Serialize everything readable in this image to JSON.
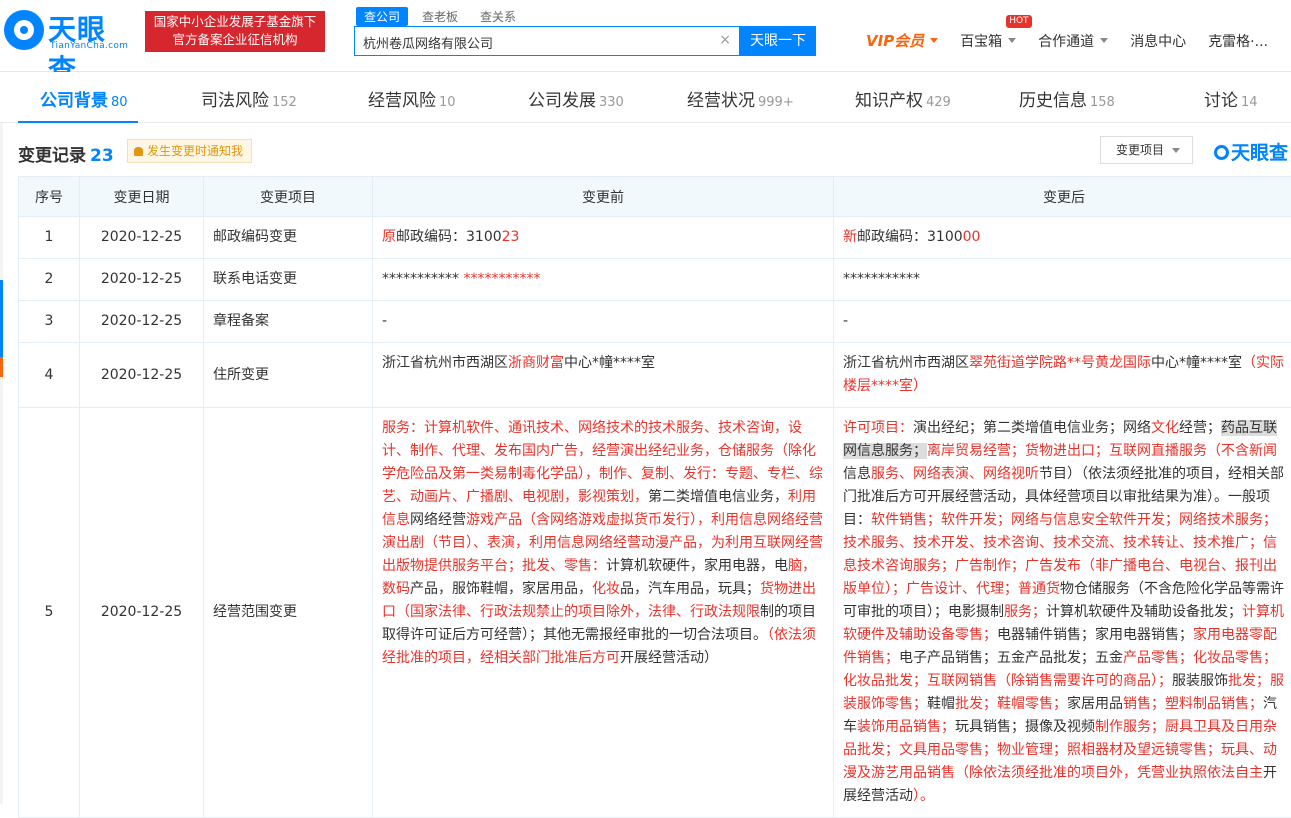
{
  "header": {
    "logo_text": "天眼查",
    "logo_sub": "TianYanCha.com",
    "gov_badge_line1": "国家中小企业发展子基金旗下",
    "gov_badge_line2": "官方备案企业征信机构",
    "search_tabs": [
      "查公司",
      "查老板",
      "查关系"
    ],
    "search_value": "杭州卷瓜网络有限公司",
    "search_button": "天眼一下",
    "nav": {
      "vip": "VIP会员",
      "treasure": "百宝箱",
      "hot": "HOT",
      "partner": "合作通道",
      "messages": "消息中心",
      "user": "克雷格·..."
    }
  },
  "tabs": [
    {
      "label": "公司背景",
      "count": "80"
    },
    {
      "label": "司法风险",
      "count": "152"
    },
    {
      "label": "经营风险",
      "count": "10"
    },
    {
      "label": "公司发展",
      "count": "330"
    },
    {
      "label": "经营状况",
      "count": "999+"
    },
    {
      "label": "知识产权",
      "count": "429"
    },
    {
      "label": "历史信息",
      "count": "158"
    },
    {
      "label": "讨论",
      "count": "14"
    }
  ],
  "section": {
    "title": "变更记录",
    "count": "23",
    "notify": "发生变更时通知我",
    "filter": "变更项目",
    "brand": "天眼查"
  },
  "table": {
    "headers": [
      "序号",
      "变更日期",
      "变更项目",
      "变更前",
      "变更后"
    ],
    "rows": [
      {
        "no": "1",
        "date": "2020-12-25",
        "item": "邮政编码变更"
      },
      {
        "no": "2",
        "date": "2020-12-25",
        "item": "联系电话变更"
      },
      {
        "no": "3",
        "date": "2020-12-25",
        "item": "章程备案",
        "before": "-",
        "after": "-"
      },
      {
        "no": "4",
        "date": "2020-12-25",
        "item": "住所变更"
      },
      {
        "no": "5",
        "date": "2020-12-25",
        "item": "经营范围变更"
      }
    ],
    "r1": {
      "before_a": "原",
      "before_b": "邮政编码：3100",
      "before_c": "23",
      "after_a": "新",
      "after_b": "邮政编码：3100",
      "after_c": "00"
    },
    "r2": {
      "before_a": "*********** ",
      "before_b": "***********",
      "after": "***********"
    },
    "r4": {
      "before_a": "浙江省杭州市西湖区",
      "before_b": "浙商财富",
      "before_c": "中心*幢****室",
      "after_a": "浙江省杭州市西湖区",
      "after_b": "翠苑街道学院路**号黄龙国际",
      "after_c": "中心*幢****室",
      "after_d": "（实际楼层****室）"
    },
    "r5": {
      "before_1": "服务：计算机软件、通讯技术、网络技术的技术服务、技术咨询，设计、制作、代理、发布国内广告，经营演出经纪业务，仓储服务（除化学危险品及第一类易制毒化学品），制作、复制、发行：专题、专栏、综艺、动画片、广播剧、电视剧，影视策划，",
      "before_2": "第二类增值电信业务，",
      "before_3": "利用信息",
      "before_4": "网络经营",
      "before_5": "游戏产品（含网络游戏虚拟货币发行），利用信息网络经营演出剧（节目）、表演，利用信息网络经营动漫产品，为利用互联网经营出版物提供服务平台；批发、零售：",
      "before_6": "计算机软硬件，家用电器，电",
      "before_7": "脑，数码",
      "before_8": "产品，服饰鞋帽，家居用品，",
      "before_9": "化妆",
      "before_10": "品，汽车用品，玩具；",
      "before_11": "货物进出口（国家法律、行政法规禁止的项目除外，法律、行政法规限",
      "before_12": "制的项目取得许可证后方可经营）；其他无需报经审批的一切合法项目。",
      "before_13": "（依法须经批准的项目，经相关部门批准后方可",
      "before_14": "开展经营活动）",
      "after_1": "许可项目：",
      "after_2": "演出经纪；第二类增值电信业务；网络",
      "after_3": "文化",
      "after_4": "经营；",
      "after_5": "药品互联网信息服务；",
      "after_6": "离岸贸易经营；货物进出口；互联网直播服务（不含",
      "after_7": "新闻",
      "after_8": "信息",
      "after_9": "服务、网络表演、网络视听",
      "after_10": "节目）（依法须经批准的项目，经相关部门批准后方可开展经营活动，具体经营项目以审批结果为准）。一般项目：",
      "after_11": "软件销售；软件开发；网络与信息安全软件开发；网络技术服务；技术服务、技术开发、技术咨询、技术交流、技术转让、技术推广；信息技术咨询服务；广告制作；广告发布（非广播电台、电视台、报刊出版单位）；广告设计、代理；普通货",
      "after_12": "物仓储服务（不含危险化学品等需许可审批的项目）；电影摄制",
      "after_13": "服务；",
      "after_14": "计算机软硬件及辅助设备批发；",
      "after_15": "计算机软硬件及辅助设备零售；",
      "after_16": "电器辅件销售；家用电器销售；",
      "after_17": "家用电器零配件销售；",
      "after_18": "电子产品销售；五金产品批发；五金",
      "after_19": "产品零售；化妆品零售；化妆品批发；互联网销售（除销售需要许可的商品）；",
      "after_20": "服装服饰",
      "after_21": "批发；服装服饰零售；",
      "after_22": "鞋帽",
      "after_23": "批发；鞋帽零售；",
      "after_24": "家居用品",
      "after_25": "销售；塑料制品销售；",
      "after_26": "汽车",
      "after_27": "装饰用品销售；",
      "after_28": "玩具销售；摄像及视频",
      "after_29": "制作服务；厨具卫具及日用杂品批发；文具用品零售；物业管理；照相器材及望远镜零售；玩具、动漫及游艺用品销售（除依法须经批准的项目外，凭营业执照依法自主",
      "after_30": "开展经营活动",
      "after_31": "）。"
    }
  }
}
